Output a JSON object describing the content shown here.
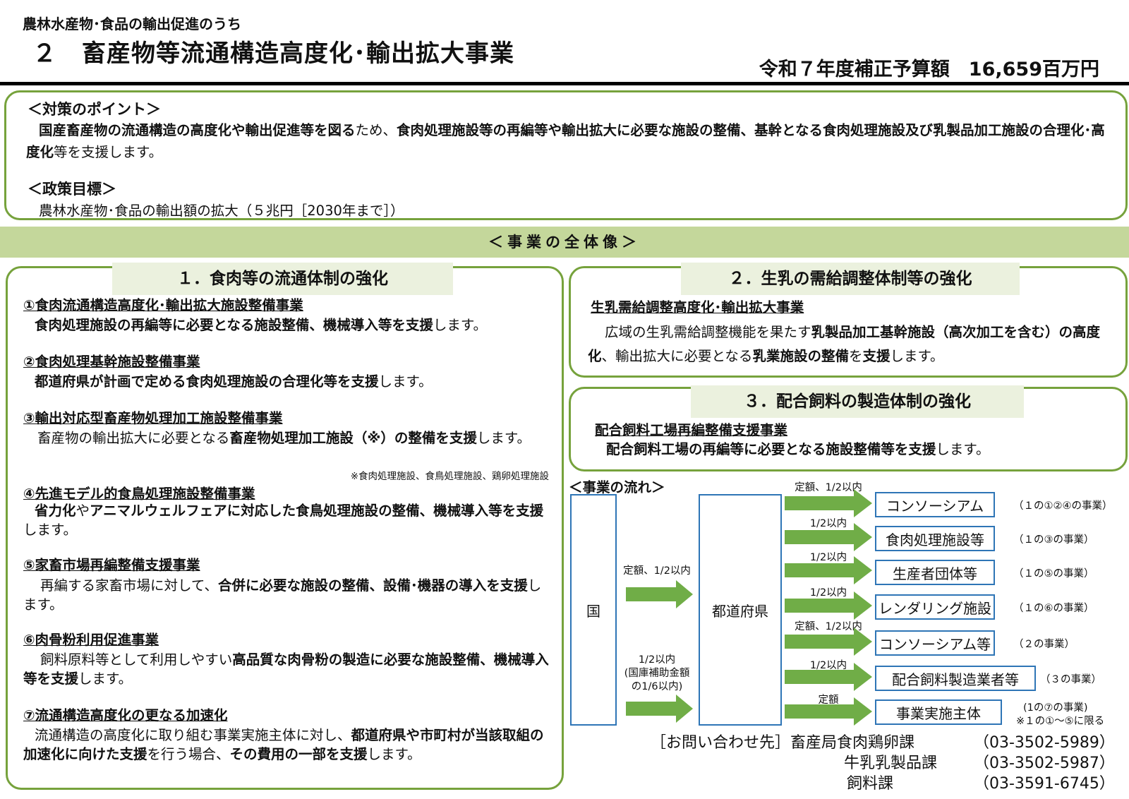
{
  "header": {
    "subtitle": "農林水産物･食品の輸出促進のうち",
    "title": "２　畜産物等流通構造高度化･輸出拡大事業",
    "budget": "令和７年度補正予算額　16,659百万円"
  },
  "points": {
    "heading": "＜対策のポイント＞",
    "body_b1": "国産畜産物の流通構造の高度化や輸出促進等を図る",
    "body_n1": "ため、",
    "body_b2": "食肉処理施設等の再編等や輸出拡大に必要な施設の整備、基幹となる食肉処理施設及び乳製品加工施設の合理化･高度化",
    "body_n2": "等を支援します。",
    "goal_heading": "＜政策目標＞",
    "goal_body": "農林水産物･食品の輸出額の拡大（５兆円［2030年まで］）"
  },
  "overview_band": "＜事業の全体像＞",
  "section1": {
    "header": "１．食肉等の流通体制の強化",
    "items": [
      {
        "title": "①食肉流通構造高度化･輸出拡大施設整備事業",
        "b1": "食肉処理施設の再編等に必要となる施設整備、機械導入等を支援",
        "n1": "します。"
      },
      {
        "title": "②食肉処理基幹施設整備事業",
        "b1": "都道府県が計画で定める食肉処理施設の合理化等を支援",
        "n1": "します。"
      },
      {
        "title": "③輸出対応型畜産物処理加工施設整備事業",
        "n0": "畜産物の輸出拡大に必要となる",
        "b1": "畜産物処理加工施設（※）の整備を支援",
        "n1": "します。",
        "note": "※食肉処理施設、食鳥処理施設、鶏卵処理施設"
      },
      {
        "title": "④先進モデル的食鳥処理施設整備事業",
        "b1": "省力化",
        "n1": "や",
        "b2": "アニマルウェルフェアに対応した食鳥処理施設の整備、機械導入等を支援",
        "n2": "します。"
      },
      {
        "title": "⑤家畜市場再編整備支援事業",
        "n0": "再編する家畜市場に対して、",
        "b1": "合併に必要な施設の整備、設備･機器の導入を支援",
        "n1": "します。"
      },
      {
        "title": "⑥肉骨粉利用促進事業",
        "n0": "飼料原料等として利用しやすい",
        "b1": "高品質な肉骨粉の製造に必要な施設整備、機械導入等を支援",
        "n1": "します。"
      },
      {
        "title": "⑦流通構造高度化の更なる加速化",
        "n0": "流通構造の高度化に取り組む事業実施主体に対し、",
        "b1": "都道府県や市町村が当該取組の加速化に向けた支援",
        "n1": "を行う場合、",
        "b2": "その費用の一部を支援",
        "n2": "します。"
      }
    ]
  },
  "section2": {
    "header": "２．生乳の需給調整体制等の強化",
    "item_title": "生乳需給調整高度化･輸出拡大事業",
    "n0": "広域の生乳需給調整機能を果たす",
    "b1": "乳製品加工基幹施設（高次加工を含む）の高度化",
    "n1": "、輸出拡大に必要となる",
    "b2": "乳業施設の整備",
    "n2": "を",
    "b3": "支援",
    "n3": "します。"
  },
  "section3": {
    "header": "３．配合飼料の製造体制の強化",
    "item_title": "配合飼料工場再編整備支援事業",
    "b1": "配合飼料工場の再編等に必要となる施設整備等を支援",
    "n1": "します。"
  },
  "flow": {
    "title": "＜事業の流れ＞",
    "country": "国",
    "prefecture": "都道府県",
    "arrow1_label": "定額、1/2以内",
    "arrow2_label_1": "1/2以内",
    "arrow2_label_2": "(国庫補助金額",
    "arrow2_label_3": "の1/6以内)",
    "rows": [
      {
        "rate": "定額、1/2以内",
        "recipient": "コンソーシアム",
        "scope": "（１の①②④の事業）"
      },
      {
        "rate": "1/2以内",
        "recipient": "食肉処理施設等",
        "scope": "（１の③の事業）"
      },
      {
        "rate": "1/2以内",
        "recipient": "生産者団体等",
        "scope": "（１の⑤の事業）"
      },
      {
        "rate": "1/2以内",
        "recipient": "レンダリング施設",
        "scope": "（１の⑥の事業）"
      },
      {
        "rate": "定額、1/2以内",
        "recipient": "コンソーシアム等",
        "scope": "（２の事業）"
      },
      {
        "rate": "1/2以内",
        "recipient": "配合飼料製造業者等",
        "scope": "（３の事業）"
      },
      {
        "rate": "定額",
        "recipient": "事業実施主体",
        "scope": "(1の⑦の事業)"
      }
    ],
    "last_note": "※１の①～⑤に限る"
  },
  "contact": {
    "label": "［お問い合わせ先］",
    "rows": [
      {
        "dept": "畜産局食肉鶏卵課",
        "tel": "（03-3502-5989）"
      },
      {
        "dept": "牛乳乳製品課",
        "tel": "（03-3502-5987）"
      },
      {
        "dept": "飼料課",
        "tel": "（03-3591-6745）"
      }
    ]
  },
  "colors": {
    "green_border": "#76a23c",
    "band": "#c4d79b",
    "header_fill": "#ebf1de",
    "arrow": "#70ad47",
    "blue_border": "#2e75b6"
  }
}
